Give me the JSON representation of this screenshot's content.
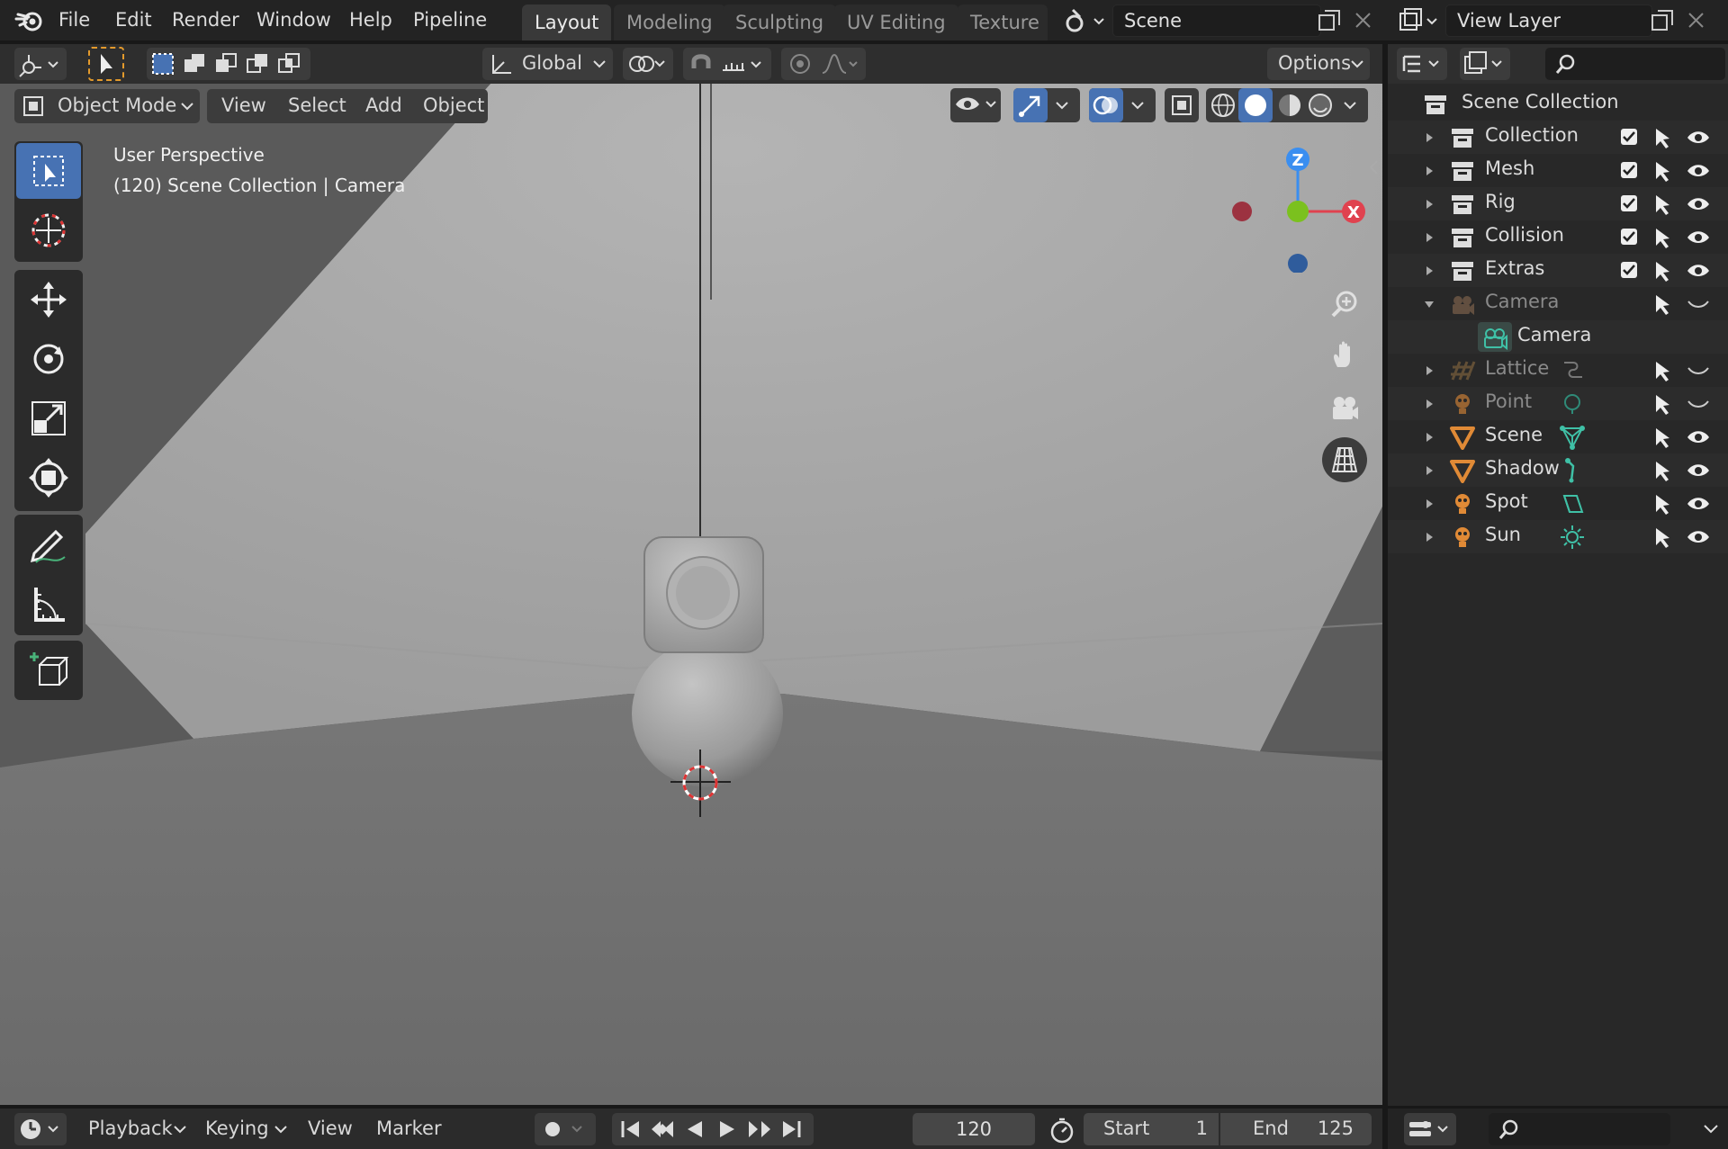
{
  "topbar": {
    "menus": [
      "File",
      "Edit",
      "Render",
      "Window",
      "Help",
      "Pipeline"
    ],
    "workspaces": [
      "Layout",
      "Modeling",
      "Sculpting",
      "UV Editing",
      "Texture P"
    ],
    "active_workspace": "Layout",
    "scene_name": "Scene",
    "view_layer": "View Layer"
  },
  "header": {
    "transform_orientation": "Global",
    "options_label": "Options",
    "mode": "Object Mode",
    "menus": [
      "View",
      "Select",
      "Add",
      "Object"
    ]
  },
  "viewport": {
    "view_name": "User Perspective",
    "view_info": "(120) Scene Collection | Camera",
    "gizmo": {
      "z": "Z",
      "x": "X"
    }
  },
  "outliner": {
    "root": "Scene Collection",
    "items": [
      {
        "label": "Collection",
        "icon": "collection-icon",
        "dim": false
      },
      {
        "label": "Mesh",
        "icon": "collection-icon",
        "dim": false
      },
      {
        "label": "Rig",
        "icon": "collection-icon",
        "dim": false
      },
      {
        "label": "Collision",
        "icon": "collection-icon",
        "dim": false
      },
      {
        "label": "Extras",
        "icon": "collection-icon",
        "dim": false
      },
      {
        "label": "Camera",
        "icon": "camera-object-icon",
        "dim": true
      },
      {
        "label": "Camera",
        "icon": "camera-data-icon",
        "dim": false
      },
      {
        "label": "Lattice",
        "icon": "lattice-icon",
        "dim": true
      },
      {
        "label": "Point",
        "icon": "light-icon",
        "dim": true
      },
      {
        "label": "Scene",
        "icon": "mesh-icon",
        "dim": false
      },
      {
        "label": "Shadow",
        "icon": "mesh-icon",
        "dim": false
      },
      {
        "label": "Spot",
        "icon": "light-icon",
        "dim": false
      },
      {
        "label": "Sun",
        "icon": "light-icon",
        "dim": false
      }
    ]
  },
  "timeline": {
    "menus": [
      "Playback",
      "Keying",
      "View",
      "Marker"
    ],
    "current_frame": "120",
    "start_label": "Start",
    "start_value": "1",
    "end_label": "End",
    "end_value": "125"
  },
  "colors": {
    "accent": "#4772b3",
    "axis_x": "#e0424f",
    "axis_y": "#7bc11e",
    "axis_z": "#3a8ef0",
    "object_orange": "#e08a36",
    "data_teal": "#3fc0a6"
  }
}
